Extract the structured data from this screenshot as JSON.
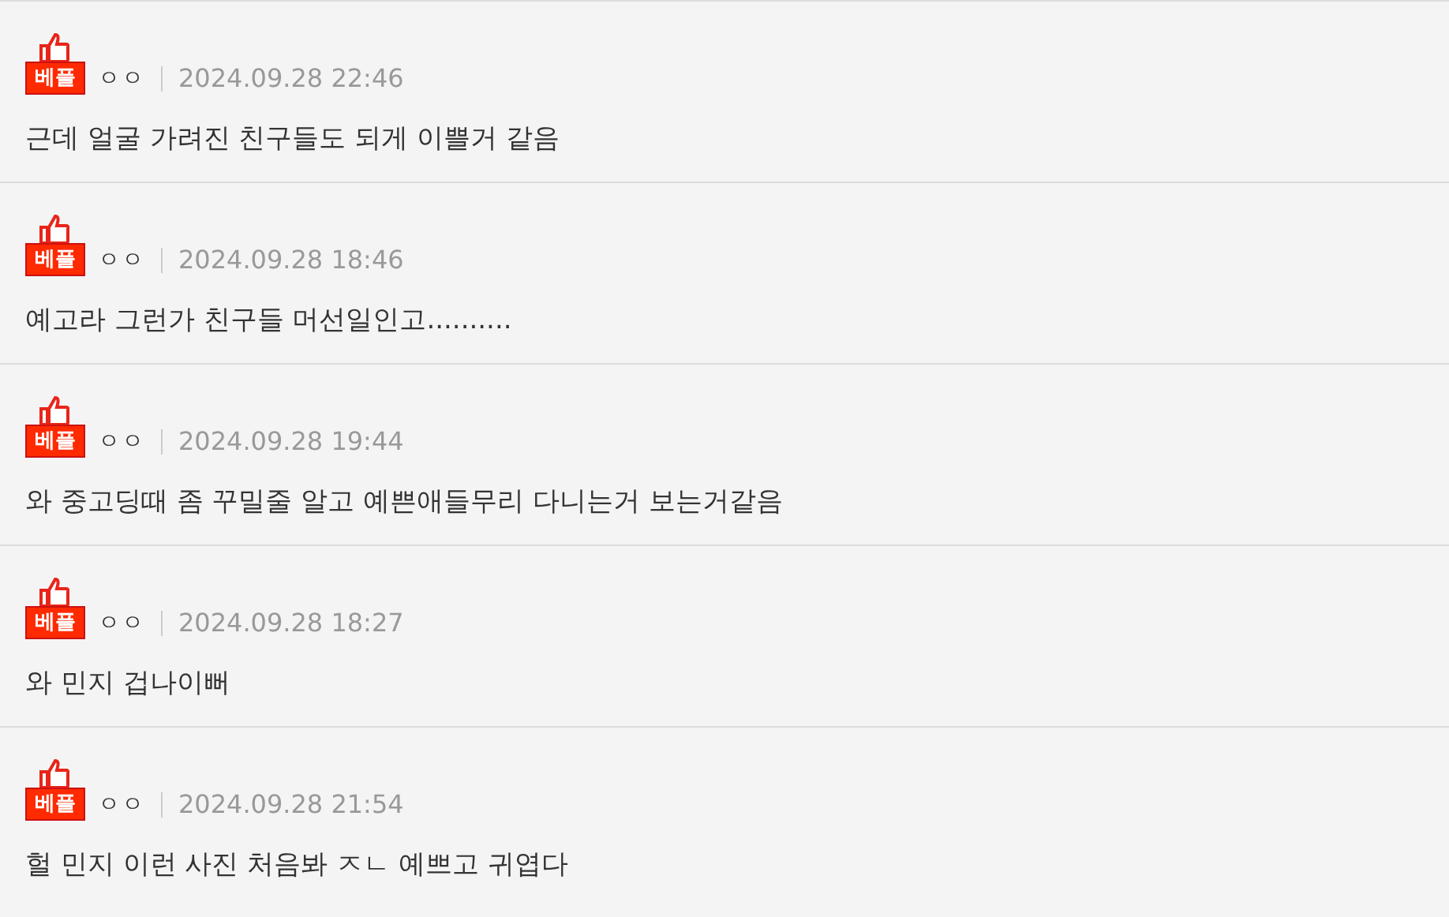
{
  "comments": [
    {
      "badge": "베플",
      "author": "ㅇㅇ",
      "date": "2024.09.28 22:46",
      "text": "근데 얼굴 가려진 친구들도 되게 이쁠거 같음"
    },
    {
      "badge": "베플",
      "author": "ㅇㅇ",
      "date": "2024.09.28 18:46",
      "text": "예고라 그런가 친구들 머선일인고.........."
    },
    {
      "badge": "베플",
      "author": "ㅇㅇ",
      "date": "2024.09.28 19:44",
      "text": "와 중고딩때 좀 꾸밀줄 알고 예쁜애들무리 다니는거 보는거같음"
    },
    {
      "badge": "베플",
      "author": "ㅇㅇ",
      "date": "2024.09.28 18:27",
      "text": "와 민지 겁나이뻐"
    },
    {
      "badge": "베플",
      "author": "ㅇㅇ",
      "date": "2024.09.28 21:54",
      "text": "헐 민지 이런 사진 처음봐 ㅈㄴ 예쁘고 귀엽다"
    }
  ]
}
